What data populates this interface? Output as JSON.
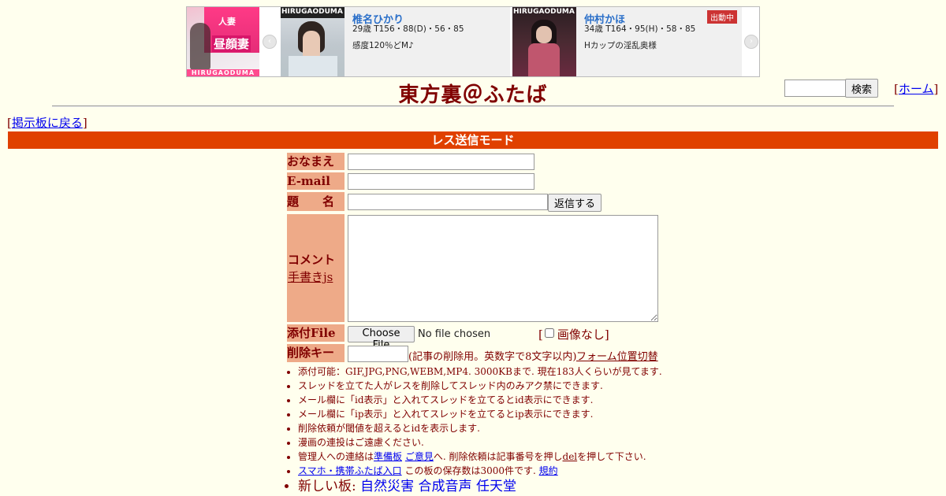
{
  "ad": {
    "card1": {
      "name": "椎名ひかり",
      "stats": "29歳 T156・88(D)・56・85",
      "desc": "感度120％どM♪"
    },
    "card2": {
      "name": "仲村かほ",
      "stats": "34歳 T164・95(H)・58・85",
      "desc": "Hカップの淫乱奥様",
      "badge": "出動中"
    },
    "thumb_left_text": [
      "昼顔妻",
      "人妻"
    ],
    "logo_text": "HIRUGAODUMA",
    "prev_icon": "‹",
    "next_icon": "›"
  },
  "header": {
    "title": "東方裏＠ふたば",
    "search_button": "検索",
    "home_link": "ホーム",
    "back_link": "掲示板に戻る"
  },
  "mode_bar": "レス送信モード",
  "form": {
    "name_label": "おなまえ",
    "email_label": "E-mail",
    "subject_label": "題　　名",
    "submit_button": "返信する",
    "comment_label": "コメント",
    "handwrite_link": "手書きjs",
    "file_label": "添付File",
    "file_button": "Choose File",
    "file_status": "No file chosen",
    "no_image_label": "画像なし",
    "delkey_label": "削除キー",
    "delkey_note": "(記事の削除用。英数字で8文字以内)",
    "toggle_link": "フォーム位置切替"
  },
  "notes": {
    "n1": "添付可能：GIF,JPG,PNG,WEBM,MP4. 3000KBまで. 現在183人くらいが見てます.",
    "n2": "スレッドを立てた人がレスを削除してスレッド内のみアク禁にできます.",
    "n3": "メール欄に「id表示」と入れてスレッドを立てるとid表示にできます.",
    "n4": "メール欄に「ip表示」と入れてスレッドを立てるとip表示にできます.",
    "n5": "削除依頼が閾値を超えるとidを表示します.",
    "n6": "漫画の連投はご遠慮ください.",
    "n7_a": "管理人への連絡は",
    "n7_link1": "準備板",
    "n7_link2": "ご意見",
    "n7_b": "へ. 削除依頼は記事番号を押し",
    "n7_link3": "del",
    "n7_c": "を押して下さい.",
    "n8_link": "スマホ・携帯ふたば入口",
    "n8_b": " この板の保存数は3000件です.",
    "n8_link2": "規約",
    "n9_a": "新しい板: ",
    "n9_link1": "自然災害",
    "n9_link2": "合成音声",
    "n9_link3": "任天堂"
  }
}
